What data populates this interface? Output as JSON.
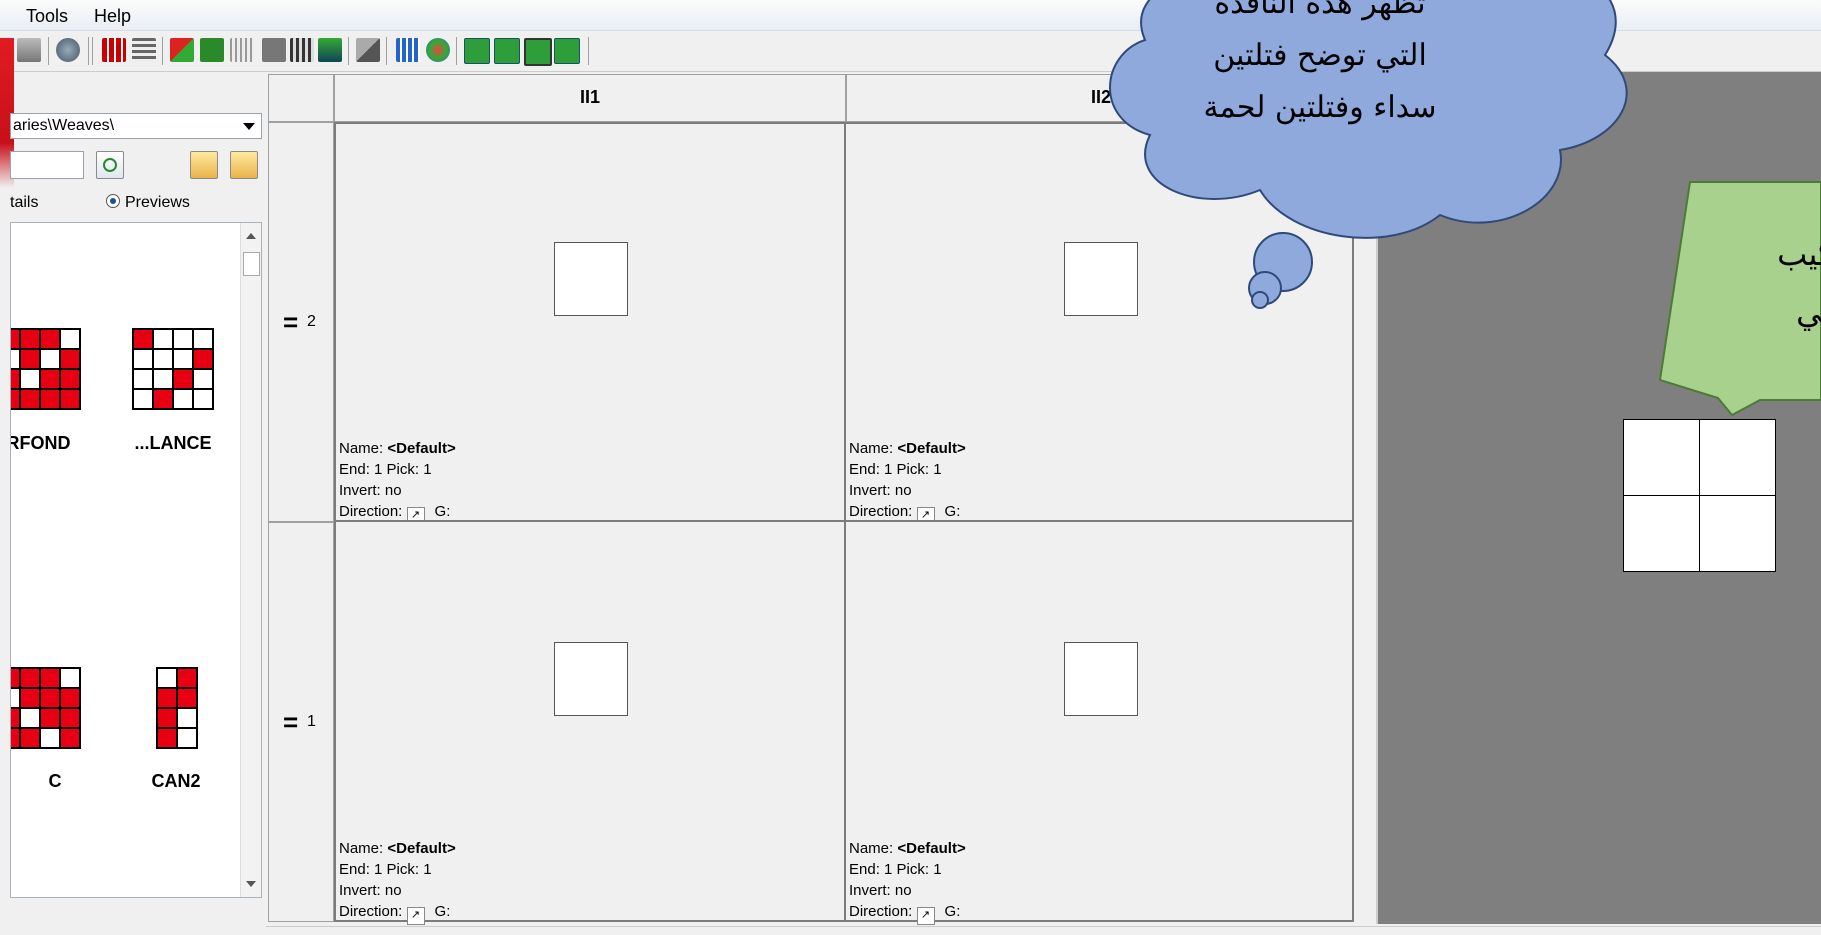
{
  "menu": {
    "items": [
      "Tools",
      "Help"
    ]
  },
  "library": {
    "path": "aries\\Weaves\\",
    "view_details": "tails",
    "view_previews": "Previews",
    "weaves": [
      {
        "label": ".RFOND"
      },
      {
        "label": "...LANCE"
      },
      {
        "label": "C"
      },
      {
        "label": "CAN2"
      }
    ]
  },
  "grid": {
    "col_headers": [
      "II1",
      "II2"
    ],
    "row_headers": [
      "2",
      "1"
    ],
    "cell_info": {
      "name_label": "Name:",
      "name_value": "<Default>",
      "end_pick": "End: 1 Pick: 1",
      "invert": "Invert: no",
      "direction_label": "Direction:",
      "g_label": "G:"
    }
  },
  "annotations": {
    "cloud": [
      "تظهر هذه النافذة",
      "التي توضح  فتلتين",
      "سداء وفتلتين لحمة"
    ],
    "green": [
      "تركيب",
      "ثنائي"
    ]
  },
  "colors": {
    "weave_red": "#e60012",
    "cloud_fill": "#8fa9dc",
    "green_fill": "#a9d18e",
    "preview_bg": "#7f7f7f"
  }
}
